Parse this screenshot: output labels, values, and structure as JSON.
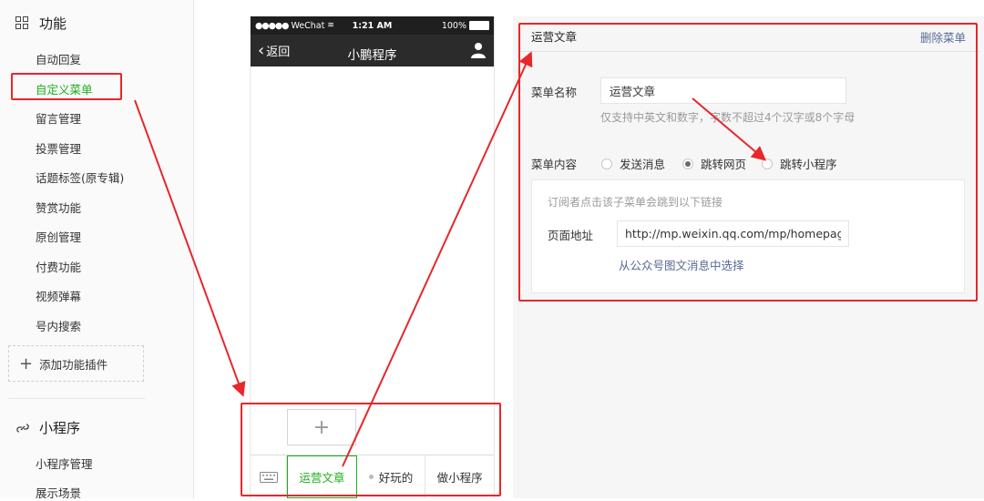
{
  "sidebar": {
    "section_function": "功能",
    "items": [
      "自动回复",
      "自定义菜单",
      "留言管理",
      "投票管理",
      "话题标签(原专辑)",
      "赞赏功能",
      "原创管理",
      "付费功能",
      "视频弹幕",
      "号内搜索"
    ],
    "add_plugin": "添加功能插件",
    "section_miniprogram": "小程序",
    "mini_items": [
      "小程序管理",
      "展示场景"
    ]
  },
  "phone": {
    "carrier": "WeChat",
    "time": "1:21 AM",
    "battery": "100%",
    "back": "返回",
    "title": "小鹏程序",
    "add_symbol": "+",
    "tabs": [
      "运营文章",
      "好玩的",
      "做小程序"
    ]
  },
  "panel": {
    "title": "运营文章",
    "delete": "删除菜单",
    "name_label": "菜单名称",
    "name_value": "运营文章",
    "name_hint": "仅支持中英文和数字，字数不超过4个汉字或8个字母",
    "content_label": "菜单内容",
    "options": [
      "发送消息",
      "跳转网页",
      "跳转小程序"
    ],
    "selected_option": "跳转网页",
    "link_desc": "订阅者点击该子菜单会跳到以下链接",
    "url_label": "页面地址",
    "url_value": "http://mp.weixin.qq.com/mp/homepag",
    "pick_link": "从公众号图文消息中选择"
  },
  "colors": {
    "accent_green": "#1aad19",
    "annotation_red": "#e8262c",
    "link_blue": "#576b95"
  }
}
